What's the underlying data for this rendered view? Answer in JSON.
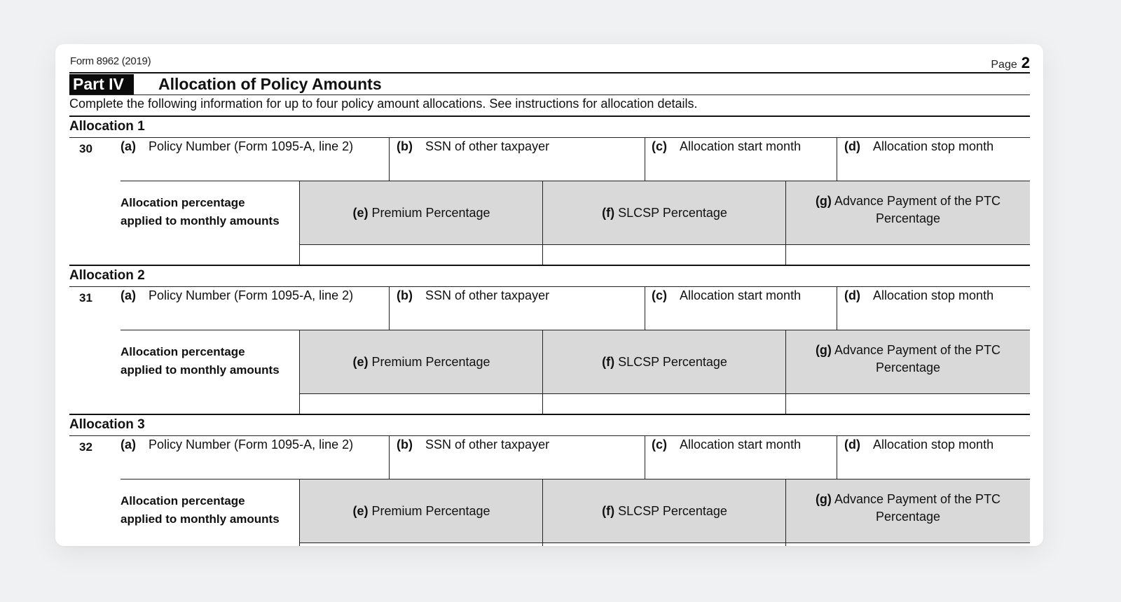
{
  "header": {
    "form_id": "Form 8962 (2019)",
    "page_label": "Page",
    "page_number": "2"
  },
  "part": {
    "badge": "Part IV",
    "title": "Allocation of Policy Amounts",
    "description": "Complete the following information for up to four policy amount allocations. See instructions for allocation details."
  },
  "allocations": [
    {
      "title": "Allocation 1",
      "line": "30",
      "fields": {
        "a": {
          "letter": "(a)",
          "label": "Policy Number (Form 1095-A, line 2)",
          "value": ""
        },
        "b": {
          "letter": "(b)",
          "label": "SSN of other taxpayer",
          "value": ""
        },
        "c": {
          "letter": "(c)",
          "label": "Allocation start month",
          "value": ""
        },
        "d": {
          "letter": "(d)",
          "label": "Allocation stop month",
          "value": ""
        }
      },
      "pct_label": "Allocation percentage applied to monthly amounts",
      "pct": {
        "e": {
          "letter": "(e)",
          "label": "Premium Percentage",
          "value": ""
        },
        "f": {
          "letter": "(f)",
          "label": "SLCSP Percentage",
          "value": ""
        },
        "g": {
          "letter": "(g)",
          "label": "Advance Payment of the PTC Percentage",
          "value": ""
        }
      }
    },
    {
      "title": "Allocation 2",
      "line": "31",
      "fields": {
        "a": {
          "letter": "(a)",
          "label": "Policy Number (Form 1095-A, line 2)",
          "value": ""
        },
        "b": {
          "letter": "(b)",
          "label": "SSN of other taxpayer",
          "value": ""
        },
        "c": {
          "letter": "(c)",
          "label": "Allocation start month",
          "value": ""
        },
        "d": {
          "letter": "(d)",
          "label": "Allocation stop month",
          "value": ""
        }
      },
      "pct_label": "Allocation percentage applied to monthly amounts",
      "pct": {
        "e": {
          "letter": "(e)",
          "label": "Premium Percentage",
          "value": ""
        },
        "f": {
          "letter": "(f)",
          "label": "SLCSP Percentage",
          "value": ""
        },
        "g": {
          "letter": "(g)",
          "label": "Advance Payment of the PTC Percentage",
          "value": ""
        }
      }
    },
    {
      "title": "Allocation 3",
      "line": "32",
      "fields": {
        "a": {
          "letter": "(a)",
          "label": "Policy Number (Form 1095-A, line 2)",
          "value": ""
        },
        "b": {
          "letter": "(b)",
          "label": "SSN of other taxpayer",
          "value": ""
        },
        "c": {
          "letter": "(c)",
          "label": "Allocation start month",
          "value": ""
        },
        "d": {
          "letter": "(d)",
          "label": "Allocation stop month",
          "value": ""
        }
      },
      "pct_label": "Allocation percentage applied to monthly amounts",
      "pct": {
        "e": {
          "letter": "(e)",
          "label": "Premium Percentage",
          "value": ""
        },
        "f": {
          "letter": "(f)",
          "label": "SLCSP Percentage",
          "value": ""
        },
        "g": {
          "letter": "(g)",
          "label": "Advance Payment of the PTC Percentage",
          "value": ""
        }
      }
    }
  ]
}
